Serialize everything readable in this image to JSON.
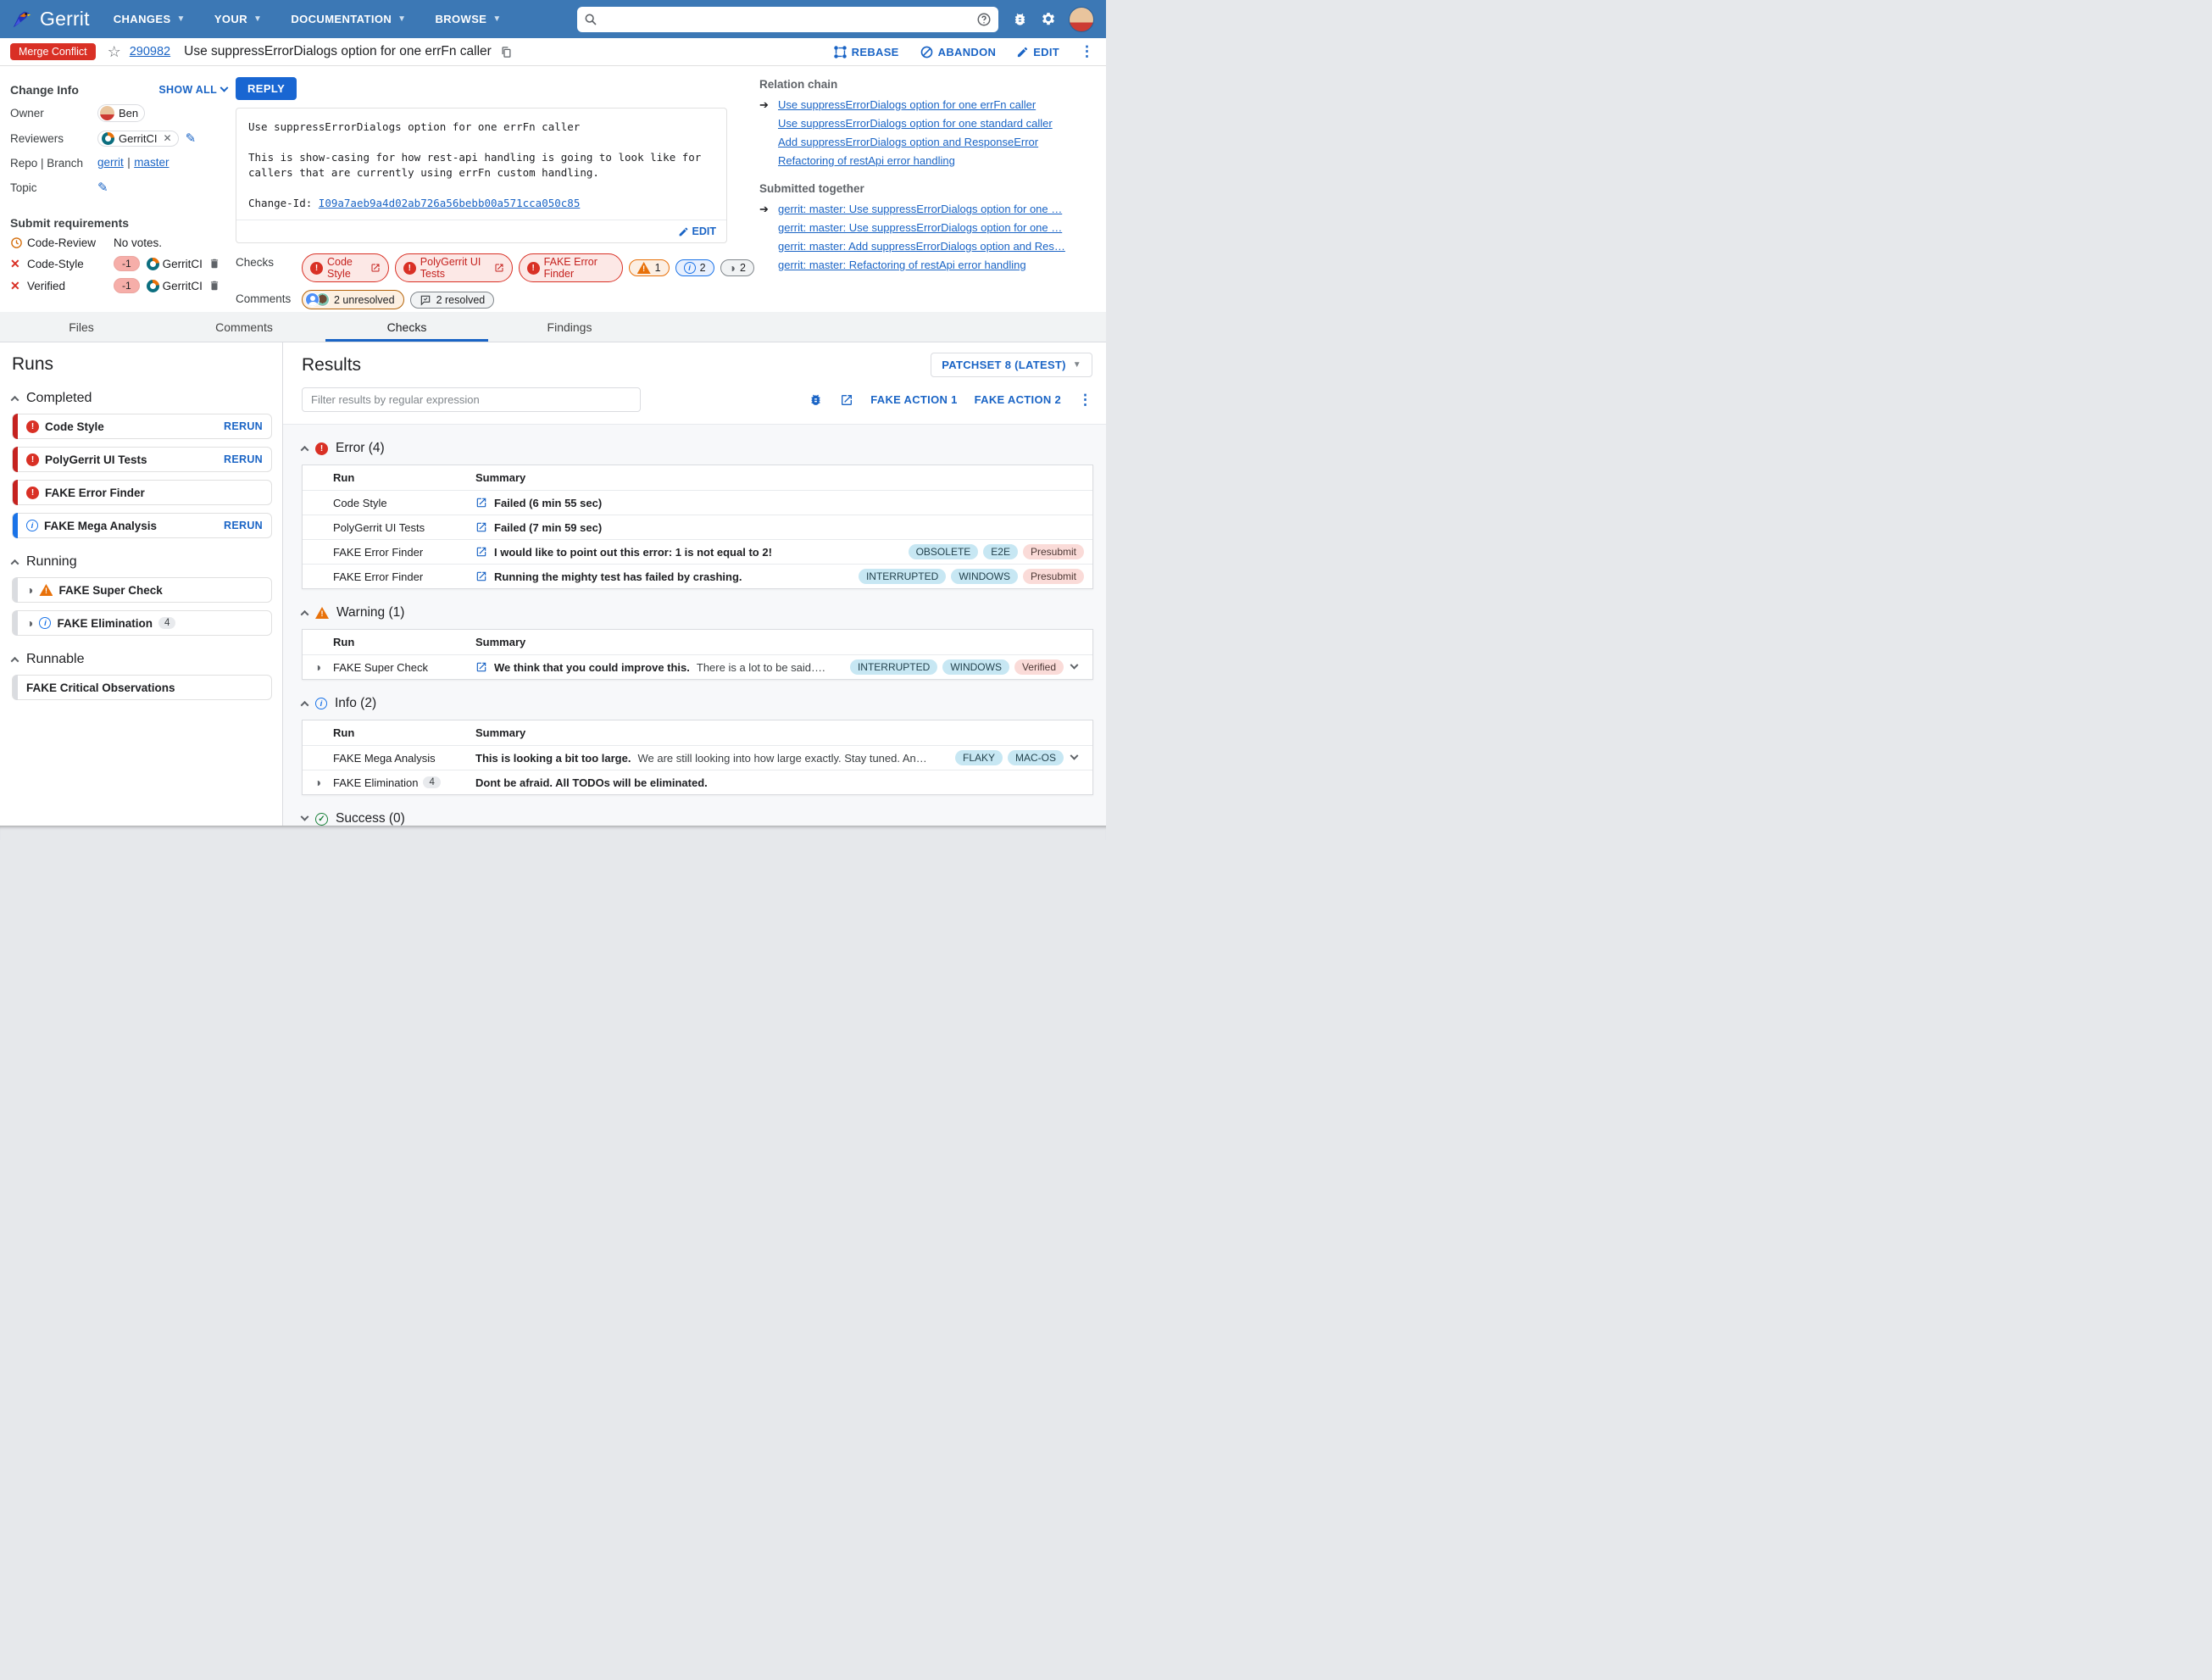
{
  "nav": {
    "brand": "Gerrit",
    "menus": [
      {
        "label": "CHANGES"
      },
      {
        "label": "YOUR"
      },
      {
        "label": "DOCUMENTATION"
      },
      {
        "label": "BROWSE"
      }
    ],
    "search": {
      "placeholder": ""
    }
  },
  "header": {
    "status_chip": "Merge Conflict",
    "change_number": "290982",
    "title": "Use suppressErrorDialogs option for one errFn caller",
    "actions": {
      "rebase": "REBASE",
      "abandon": "ABANDON",
      "edit": "EDIT"
    }
  },
  "change_info": {
    "heading": "Change Info",
    "show_all": "SHOW ALL",
    "owner_label": "Owner",
    "owner": "Ben",
    "reviewers_label": "Reviewers",
    "reviewer": "GerritCI",
    "repo_branch_label": "Repo | Branch",
    "repo": "gerrit",
    "separator": "|",
    "branch": "master",
    "topic_label": "Topic"
  },
  "submit_requirements": {
    "heading": "Submit requirements",
    "code_review": {
      "name": "Code-Review",
      "note": "No votes."
    },
    "code_style": {
      "name": "Code-Style",
      "vote": "-1",
      "account": "GerritCI"
    },
    "verified": {
      "name": "Verified",
      "vote": "-1",
      "account": "GerritCI"
    }
  },
  "reply": {
    "label": "REPLY"
  },
  "commit": {
    "title_line": "Use suppressErrorDialogs option for one errFn caller",
    "body_line1": "This is show-casing for how rest-api handling is going to look like for",
    "body_line2": "callers that are currently using errFn custom handling.",
    "change_id_label": "Change-Id: ",
    "change_id": "I09a7aeb9a4d02ab726a56bebb00a571cca050c85",
    "edit_label": "EDIT"
  },
  "checks_summary": {
    "label": "Checks",
    "fail_chips": [
      {
        "label": "Code Style"
      },
      {
        "label": "PolyGerrit UI Tests"
      },
      {
        "label": "FAKE Error Finder"
      }
    ],
    "warning_count": "1",
    "info_count": "2",
    "running_count": "2"
  },
  "comments_summary": {
    "label": "Comments",
    "unresolved": "2 unresolved",
    "resolved": "2 resolved"
  },
  "relation_chain": {
    "heading": "Relation chain",
    "items": [
      {
        "label": "Use suppressErrorDialogs option for one errFn caller"
      },
      {
        "label": "Use suppressErrorDialogs option for one standard caller"
      },
      {
        "label": "Add suppressErrorDialogs option and ResponseError"
      },
      {
        "label": "Refactoring of restApi error handling"
      }
    ]
  },
  "submitted_together": {
    "heading": "Submitted together",
    "items": [
      {
        "label": "gerrit: master: Use suppressErrorDialogs option for one …"
      },
      {
        "label": "gerrit: master: Use suppressErrorDialogs option for one …"
      },
      {
        "label": "gerrit: master: Add suppressErrorDialogs option and Res…"
      },
      {
        "label": "gerrit: master: Refactoring of restApi error handling"
      }
    ]
  },
  "tabs": [
    {
      "label": "Files"
    },
    {
      "label": "Comments"
    },
    {
      "label": "Checks"
    },
    {
      "label": "Findings"
    }
  ],
  "runs_panel": {
    "title": "Runs",
    "completed": {
      "name": "Completed",
      "items": [
        {
          "label": "Code Style",
          "action": "RERUN"
        },
        {
          "label": "PolyGerrit UI Tests",
          "action": "RERUN"
        },
        {
          "label": "FAKE Error Finder"
        },
        {
          "label": "FAKE Mega Analysis",
          "action": "RERUN"
        }
      ]
    },
    "running": {
      "name": "Running",
      "items": [
        {
          "label": "FAKE Super Check"
        },
        {
          "label": "FAKE Elimination",
          "badge": "4"
        }
      ]
    },
    "runnable": {
      "name": "Runnable",
      "items": [
        {
          "label": "FAKE Critical Observations"
        }
      ]
    }
  },
  "results_panel": {
    "title": "Results",
    "patchset": "PATCHSET 8 (LATEST)",
    "filter_placeholder": "Filter results by regular expression",
    "action1": "FAKE ACTION 1",
    "action2": "FAKE ACTION 2",
    "columns": {
      "run": "Run",
      "summary": "Summary"
    },
    "error": {
      "heading": "Error (4)",
      "rows": [
        {
          "run": "Code Style",
          "summary": "Failed (6 min 55 sec)"
        },
        {
          "run": "PolyGerrit UI Tests",
          "summary": "Failed (7 min 59 sec)"
        },
        {
          "run": "FAKE Error Finder",
          "summary": "I would like to point out this error: 1 is not equal to 2!",
          "tags": [
            {
              "label": "OBSOLETE"
            },
            {
              "label": "E2E"
            },
            {
              "label": "Presubmit"
            }
          ]
        },
        {
          "run": "FAKE Error Finder",
          "summary": "Running the mighty test has failed by crashing.",
          "tags": [
            {
              "label": "INTERRUPTED"
            },
            {
              "label": "WINDOWS"
            },
            {
              "label": "Presubmit"
            }
          ]
        }
      ]
    },
    "warning": {
      "heading": "Warning (1)",
      "rows": [
        {
          "run": "FAKE Super Check",
          "summary": "We think that you could improve this.",
          "summary_rest": "There is a lot to be said….",
          "tags": [
            {
              "label": "INTERRUPTED"
            },
            {
              "label": "WINDOWS"
            },
            {
              "label": "Verified"
            }
          ]
        }
      ]
    },
    "info": {
      "heading": "Info (2)",
      "rows": [
        {
          "run": "FAKE Mega Analysis",
          "summary": "This is looking a bit too large.",
          "summary_rest": "We are still looking into how large exactly. Stay tuned. An…",
          "tags": [
            {
              "label": "FLAKY"
            },
            {
              "label": "MAC-OS"
            }
          ]
        },
        {
          "run": "FAKE Elimination",
          "badge": "4",
          "summary": "Dont be afraid. All TODOs will be eliminated."
        }
      ]
    },
    "success": {
      "heading": "Success (0)"
    }
  }
}
